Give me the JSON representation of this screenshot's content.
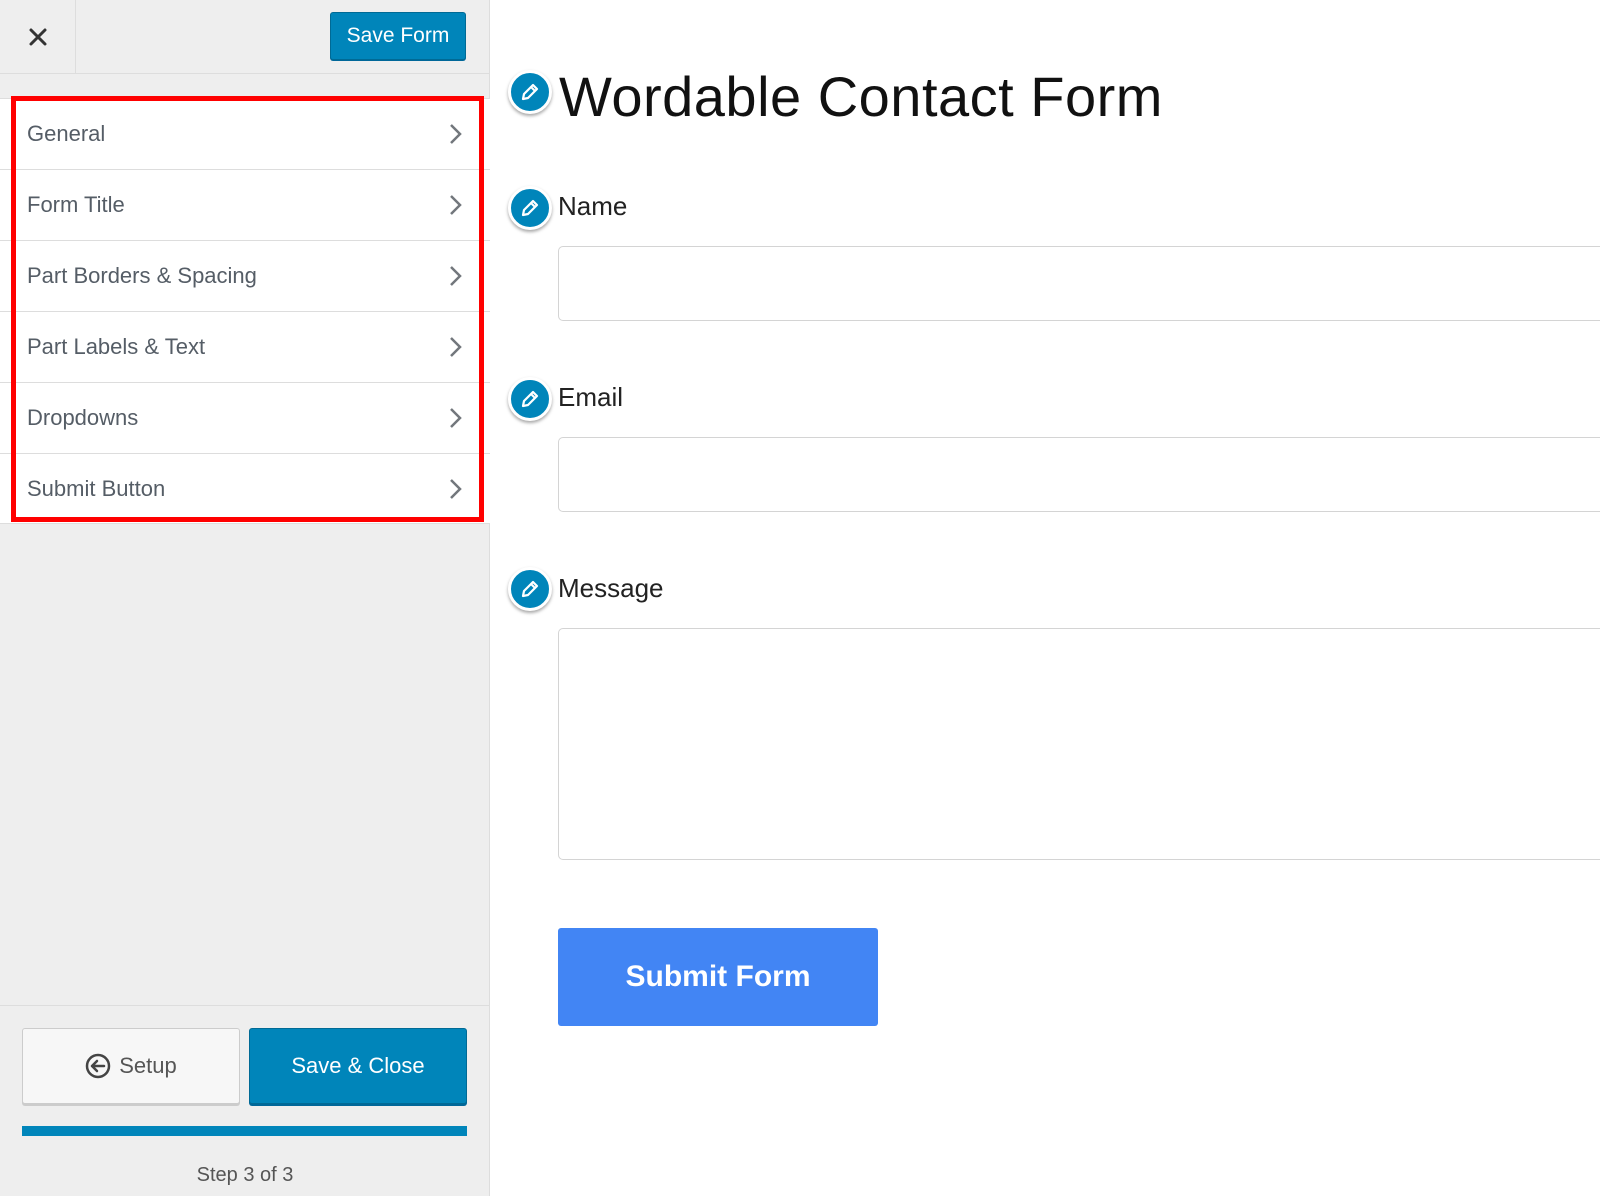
{
  "header": {
    "close_icon": "close-icon",
    "save_form_label": "Save Form"
  },
  "menu": {
    "items": [
      {
        "label": "General"
      },
      {
        "label": "Form Title"
      },
      {
        "label": "Part Borders & Spacing"
      },
      {
        "label": "Part Labels & Text"
      },
      {
        "label": "Dropdowns"
      },
      {
        "label": "Submit Button"
      }
    ]
  },
  "footer": {
    "setup_label": "Setup",
    "save_close_label": "Save & Close",
    "progress": 1.0,
    "step_label": "Step 3 of 3"
  },
  "preview": {
    "title": "Wordable Contact Form",
    "fields": [
      {
        "label": "Name"
      },
      {
        "label": "Email"
      },
      {
        "label": "Message"
      }
    ],
    "submit_label": "Submit Form"
  },
  "colors": {
    "accent": "#0085ba",
    "submit": "#4285f4",
    "highlight": "#ff0000",
    "sidebar_bg": "#eeeeee"
  }
}
